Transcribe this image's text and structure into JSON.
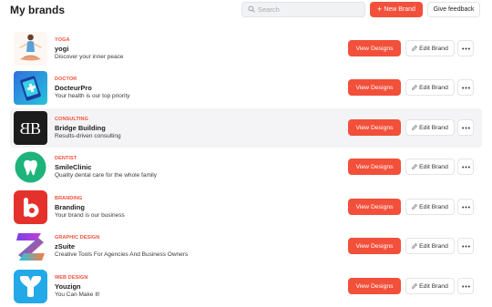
{
  "header": {
    "title": "My brands",
    "search_placeholder": "Search",
    "new_brand_label": "New Brand",
    "feedback_label": "Give feedback"
  },
  "actions": {
    "view_label": "View Designs",
    "edit_label": "Edit Brand"
  },
  "brands": [
    {
      "category": "YOGA",
      "name": "yogi",
      "tagline": "Discover your inner peace",
      "logo": "yoga-person-logo",
      "highlighted": false
    },
    {
      "category": "DOCTOR",
      "name": "DocteurPro",
      "tagline": "Your health is our top priority",
      "logo": "medical-phone-logo",
      "highlighted": false
    },
    {
      "category": "CONSULTING",
      "name": "Bridge Building",
      "tagline": "Results-driven consulting",
      "logo": "bb-monogram-logo",
      "highlighted": true
    },
    {
      "category": "DENTIST",
      "name": "SmileClinic",
      "tagline": "Quality dental care for the whole family",
      "logo": "tooth-logo",
      "highlighted": false
    },
    {
      "category": "BRANDING",
      "name": "Branding",
      "tagline": "Your brand is our business",
      "logo": "b-letter-logo",
      "highlighted": false
    },
    {
      "category": "GRAPHIC DESIGN",
      "name": "zSuite",
      "tagline": "Creative Tools For Agencies And Business Owners",
      "logo": "z-gradient-logo",
      "highlighted": false
    },
    {
      "category": "WEB DESIGN",
      "name": "Youzign",
      "tagline": "You Can Make It!",
      "logo": "y-letter-logo",
      "highlighted": false
    }
  ],
  "colors": {
    "accent": "#f2503a",
    "row_highlight": "#f4f4f6",
    "button_border": "#e2e4e7"
  }
}
